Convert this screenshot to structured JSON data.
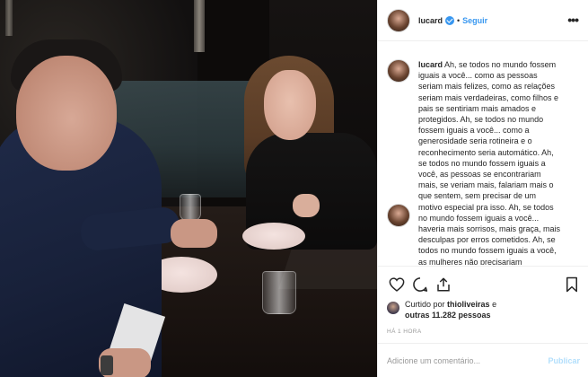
{
  "post": {
    "username": "lucard",
    "verified": true,
    "separator": "•",
    "follow_label": "Seguir",
    "more_label": "•••",
    "caption_username": "lucard",
    "caption_text": "Ah, se todos no mundo fossem iguais a você... como as pessoas seriam mais felizes, como as relações seriam mais verdadeiras, como filhos e pais se sentiriam mais amados e protegidos. Ah, se todos no mundo fossem iguais a você... como a generosidade seria rotineira e o reconhecimento seria automático. Ah, se todos no mundo fossem iguais a você, as pessoas se encontrariam mais, se veriam mais, falariam mais o que sentem, sem precisar de um motivo especial pra isso. Ah, se todos no mundo fossem iguais a você... haveria mais sorrisos, mais graça, mais desculpas por erros cometidos. Ah, se todos no mundo fossem iguais a você, as mulheres não precisariam",
    "liked_by_prefix": "Curtido por",
    "liked_by_user": "thioliveiras",
    "liked_by_joiner": "e",
    "liked_by_others": "outras 11.282 pessoas",
    "timestamp": "Há 1 hora",
    "comment_placeholder": "Adicione um comentário...",
    "publish_label": "Publicar"
  },
  "icons": {
    "like": "heart-icon",
    "comment": "comment-icon",
    "share": "share-icon",
    "save": "bookmark-icon",
    "verified": "verified-badge-icon",
    "more": "more-options-icon"
  },
  "colors": {
    "link_blue": "#3897f0",
    "publish_disabled": "#b2dffc",
    "text": "#262626",
    "muted": "#999999",
    "border": "#efefef"
  }
}
